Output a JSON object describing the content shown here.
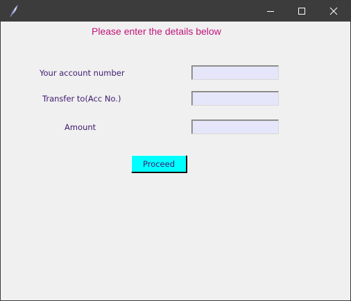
{
  "window": {
    "app_icon": "feather-icon",
    "controls": {
      "minimize": "minimize-icon",
      "maximize": "maximize-icon",
      "close": "close-icon"
    }
  },
  "form": {
    "heading": "Please enter the details below",
    "fields": [
      {
        "label": "Your account number",
        "value": ""
      },
      {
        "label": "Transfer to(Acc No.)",
        "value": ""
      },
      {
        "label": "Amount",
        "value": ""
      }
    ],
    "proceed_label": "Proceed"
  },
  "colors": {
    "heading": "#c0157a",
    "label": "#3d1a6e",
    "field_bg": "#e6e6fa",
    "button_bg": "#00ffff",
    "window_bg": "#f0f0f0",
    "titlebar_bg": "#3c3c3c"
  }
}
